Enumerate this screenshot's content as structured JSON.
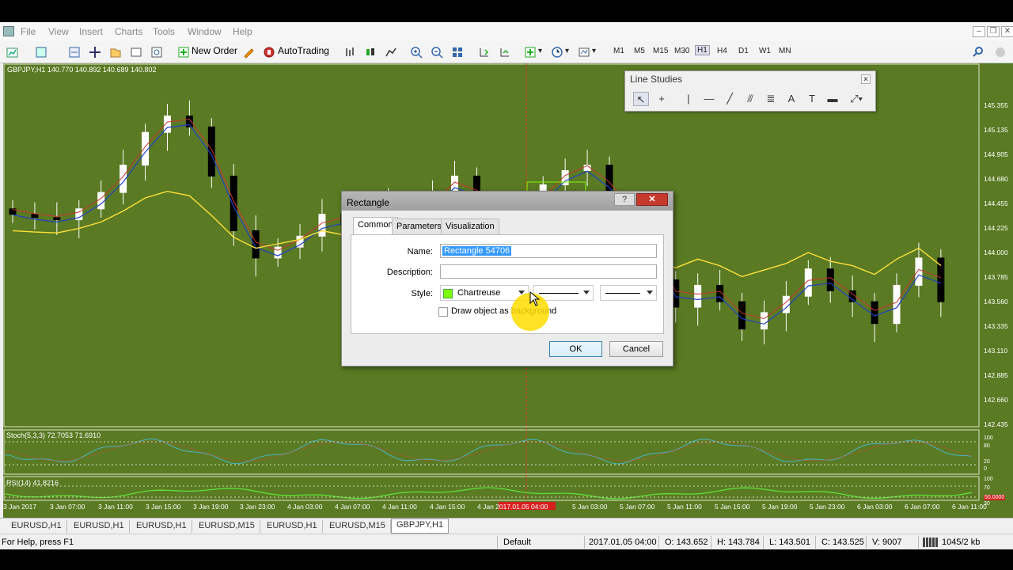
{
  "menu": {
    "items": [
      "File",
      "View",
      "Insert",
      "Charts",
      "Tools",
      "Window",
      "Help"
    ],
    "window_controls": [
      "minimize",
      "restore",
      "close"
    ]
  },
  "toolbar": {
    "new_order_label": "New Order",
    "autotrading_label": "AutoTrading",
    "timeframes": [
      "M1",
      "M5",
      "M15",
      "M30",
      "H1",
      "H4",
      "D1",
      "W1",
      "MN"
    ],
    "active_timeframe": "H1"
  },
  "chart": {
    "header": "GBPJPY,H1  140.770 140.892 140.689 140.802",
    "background_color": "#5a7a23",
    "price_labels": [
      "145.355",
      "145.135",
      "144.905",
      "144.680",
      "144.455",
      "144.225",
      "144.000",
      "143.785",
      "143.560",
      "143.335",
      "143.110",
      "142.885",
      "142.660",
      "142.435"
    ],
    "stoch_header": "Stoch(5,3,3) 72.7053 71.6910",
    "stoch_levels": [
      "100",
      "80",
      "20",
      "0"
    ],
    "rsi_header": "RSI(14) 41.8216",
    "rsi_levels": [
      "100",
      "70",
      "50.0000",
      "30",
      "0"
    ],
    "time_labels": [
      "3 Jan 2017",
      "3 Jan 07:00",
      "3 Jan 11:00",
      "3 Jan 15:00",
      "3 Jan 19:00",
      "3 Jan 23:00",
      "4 Jan 03:00",
      "4 Jan 07:00",
      "4 Jan 11:00",
      "4 Jan 15:00",
      "4 Jan 2017.01.05 04:00",
      "5 Jan 03:00",
      "5 Jan 07:00",
      "5 Jan 11:00",
      "5 Jan 15:00",
      "5 Jan 19:00",
      "5 Jan 23:00",
      "6 Jan 03:00",
      "6 Jan 07:00",
      "6 Jan 11:00"
    ],
    "highlight_time": "2017.01.05 04:00",
    "candle_closes": [
      144.35,
      144.32,
      144.3,
      144.4,
      144.55,
      144.8,
      145.1,
      145.25,
      145.15,
      144.7,
      144.2,
      143.95,
      144.05,
      144.15,
      144.35,
      144.25,
      144.05,
      144.45,
      144.3,
      144.55,
      144.7,
      144.4,
      144.2,
      144.35,
      144.62,
      144.75,
      144.8,
      144.45,
      144.3,
      143.75,
      143.5,
      143.7,
      143.55,
      143.3,
      143.45,
      143.6,
      143.85,
      143.65,
      143.55,
      143.35,
      143.7,
      143.95,
      143.55
    ]
  },
  "line_studies": {
    "title": "Line Studies",
    "tools": [
      "cursor-icon",
      "crosshair-icon",
      "vertical-line-icon",
      "horizontal-line-icon",
      "trendline-icon",
      "fibonacci-icon",
      "channel-icon",
      "text-icon",
      "text-label-icon",
      "rectangle-label-icon",
      "shapes-menu-icon"
    ]
  },
  "dialog": {
    "title": "Rectangle",
    "help_label": "?",
    "close_label": "✕",
    "tabs": [
      "Common",
      "Parameters",
      "Visualization"
    ],
    "active_tab": "Common",
    "name_label": "Name:",
    "name_value": "Rectangle 54706",
    "description_label": "Description:",
    "description_value": "",
    "style_label": "Style:",
    "color_name": "Chartreuse",
    "color_hex": "#7fff00",
    "background_checkbox_label": "Draw object as background",
    "background_checked": false,
    "ok_label": "OK",
    "cancel_label": "Cancel"
  },
  "chart_tabs": {
    "items": [
      "EURUSD,H1",
      "EURUSD,H1",
      "EURUSD,H1",
      "EURUSD,M15",
      "EURUSD,H1",
      "EURUSD,M15",
      "GBPJPY,H1"
    ],
    "active": "GBPJPY,H1"
  },
  "status": {
    "help_text": "For Help, press F1",
    "profile": "Default",
    "datetime": "2017.01.05 04:00",
    "open": "O: 143.652",
    "high": "H: 143.784",
    "low": "L: 143.501",
    "close": "C: 143.525",
    "volume": "V: 9007",
    "traffic": "1045/2 kb"
  }
}
